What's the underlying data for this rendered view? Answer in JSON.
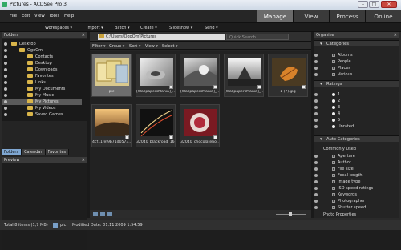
{
  "window": {
    "title": "Pictures - ACDSee Pro 3",
    "minimize": "–",
    "maximize": "□",
    "close": "✕"
  },
  "menu": [
    "File",
    "Edit",
    "View",
    "Tools",
    "Help"
  ],
  "modes": [
    "Manage",
    "View",
    "Process",
    "Online"
  ],
  "active_mode": "Manage",
  "toolbar": [
    "Workspaces ▾",
    "Import ▾",
    "Batch ▾",
    "Create ▾",
    "Slideshow ▾",
    "Send ▾"
  ],
  "folders_panel": {
    "title": "Folders",
    "close": "✕",
    "tree": [
      {
        "label": "Desktop",
        "level": 0,
        "selected": false
      },
      {
        "label": "OgoOm",
        "level": 1,
        "selected": false
      },
      {
        "label": "Contacts",
        "level": 2,
        "selected": false
      },
      {
        "label": "Desktop",
        "level": 2,
        "selected": false
      },
      {
        "label": "Downloads",
        "level": 2,
        "selected": false
      },
      {
        "label": "Favorites",
        "level": 2,
        "selected": false
      },
      {
        "label": "Links",
        "level": 2,
        "selected": false
      },
      {
        "label": "My Documents",
        "level": 2,
        "selected": false
      },
      {
        "label": "My Music",
        "level": 2,
        "selected": false
      },
      {
        "label": "My Pictures",
        "level": 2,
        "selected": true
      },
      {
        "label": "My Videos",
        "level": 2,
        "selected": false
      },
      {
        "label": "Saved Games",
        "level": 2,
        "selected": false
      }
    ],
    "tabs": [
      "Folders",
      "Calendar",
      "Favorites"
    ],
    "active_tab": "Folders"
  },
  "preview_panel": {
    "title": "Preview",
    "close": "✕"
  },
  "address": {
    "path": "C:\\Users\\OgoOm\\Pictures",
    "search_placeholder": "Quick Search"
  },
  "filters": [
    "Filter ▾",
    "Group ▾",
    "Sort ▾",
    "View ▾",
    "Select ▾"
  ],
  "thumbnails": [
    {
      "caption": "pic",
      "selected": true
    },
    {
      "caption": "[WallpapersMania]_...",
      "selected": false
    },
    {
      "caption": "[WallpapersMania]_...",
      "selected": false
    },
    {
      "caption": "[WallpapersMania]_...",
      "selected": false
    },
    {
      "caption": "1 (7).jpg",
      "selected": false
    },
    {
      "caption": "4cf11fef9b71d0573...",
      "selected": false
    },
    {
      "caption": "32040_blackroad_16...",
      "selected": false
    },
    {
      "caption": "32040_chocolatebo...",
      "selected": false
    }
  ],
  "organize_panel": {
    "title": "Organize",
    "close": "✕",
    "categories_title": "Categories",
    "categories": [
      "Albums",
      "People",
      "Places",
      "Various"
    ],
    "ratings_title": "Ratings",
    "ratings": [
      "1",
      "2",
      "3",
      "4",
      "5",
      "Unrated"
    ],
    "auto_title": "Auto Categories",
    "auto_group": "Commonly Used",
    "auto_items": [
      "Aperture",
      "Author",
      "File size",
      "Focal length",
      "Image type",
      "ISO speed ratings",
      "Keywords",
      "Photographer",
      "Shutter speed"
    ],
    "photo_properties": "Photo Properties"
  },
  "status": {
    "total": "Total 8 items  (1,7 MB)",
    "selected": "pic",
    "modified": "Modified Date: 01.11.2009 1:54:59"
  }
}
